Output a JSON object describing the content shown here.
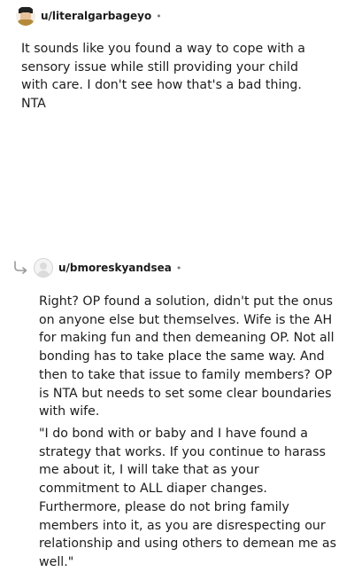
{
  "comments": [
    {
      "username": "u/literalgarbageyo",
      "separator": "•",
      "avatar_icon": "user-avatar-icon",
      "paragraphs": [
        "It sounds like you found a way to cope with a sensory issue while still providing your child with care. I don't see how that's a bad thing. NTA"
      ]
    },
    {
      "username": "u/bmoreskyandsea",
      "separator": "•",
      "avatar_icon": "default-avatar-icon",
      "reply_icon": "reply-arrow-icon",
      "paragraphs": [
        "Right? OP found a solution, didn't put the onus on anyone else but themselves. Wife is the AH for making fun and then demeaning OP. Not all bonding has to take place the same way. And then to take that issue to family members? OP is NTA but needs to set some clear boundaries with wife.",
        "\"I do bond with or baby and I have found a strategy that works. If you continue to harass me about it, I will take that as your commitment to ALL diaper changes. Furthermore, please do not bring family members into it, as you are disrespecting our relationship and using others to demean me as well.\""
      ]
    }
  ]
}
